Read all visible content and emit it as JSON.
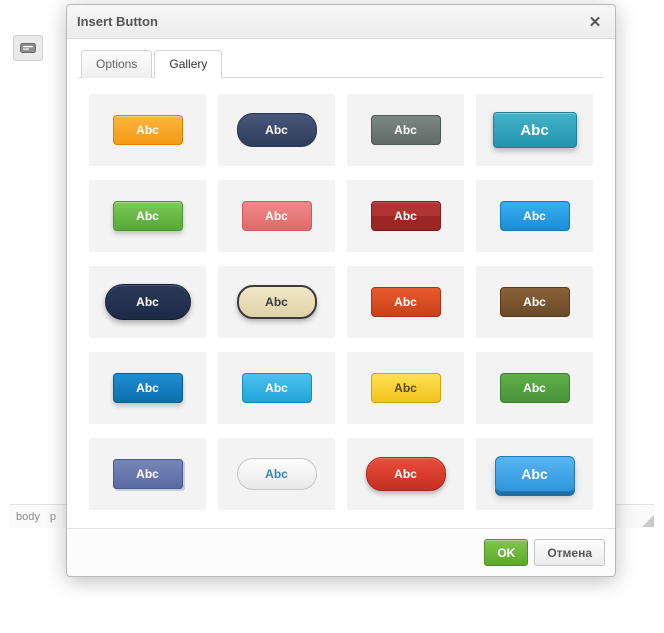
{
  "statusbar": {
    "path1": "body",
    "path2": "p"
  },
  "dialog": {
    "title": "Insert Button",
    "tabs": [
      {
        "label": "Options",
        "active": false
      },
      {
        "label": "Gallery",
        "active": true
      }
    ],
    "gallery": {
      "sample_text": "Abc",
      "items": [
        {
          "style": "s0",
          "name": "orange-rounded"
        },
        {
          "style": "s1",
          "name": "navy-pill"
        },
        {
          "style": "s2",
          "name": "gray-flat"
        },
        {
          "style": "s3",
          "name": "teal-large"
        },
        {
          "style": "s4",
          "name": "green-raised"
        },
        {
          "style": "s5",
          "name": "pink-flat"
        },
        {
          "style": "s6",
          "name": "darkred-gloss"
        },
        {
          "style": "s7",
          "name": "blue-outline"
        },
        {
          "style": "s8",
          "name": "darknavy-pill"
        },
        {
          "style": "s9",
          "name": "cream-pill"
        },
        {
          "style": "s10",
          "name": "orange-dark"
        },
        {
          "style": "s11",
          "name": "brown-flat"
        },
        {
          "style": "s12",
          "name": "blue-raised"
        },
        {
          "style": "s13",
          "name": "skyblue-flat"
        },
        {
          "style": "s14",
          "name": "yellow-flat"
        },
        {
          "style": "s15",
          "name": "green-flat"
        },
        {
          "style": "s16",
          "name": "slate-shadow"
        },
        {
          "style": "s17",
          "name": "white-pill"
        },
        {
          "style": "s18",
          "name": "red-pill"
        },
        {
          "style": "s19",
          "name": "blue-3d"
        }
      ]
    },
    "footer": {
      "ok": "OK",
      "cancel": "Отмена"
    }
  }
}
